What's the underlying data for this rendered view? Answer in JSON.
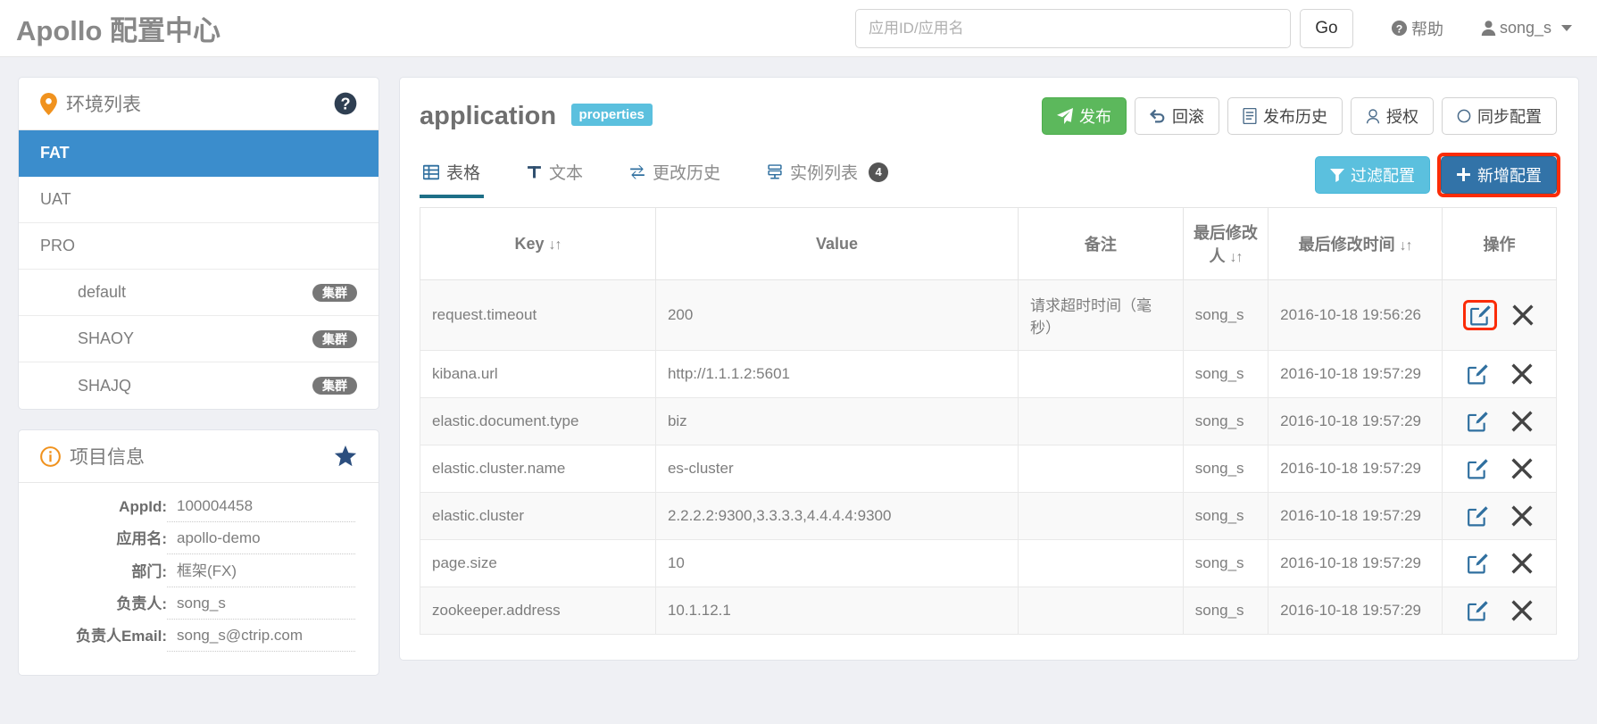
{
  "header": {
    "brand_en": "Apollo",
    "brand_cn": " 配置中心",
    "search_placeholder": "应用ID/应用名",
    "search_value": "",
    "go_label": "Go",
    "help_label": "帮助",
    "user_label": "song_s"
  },
  "sidebar": {
    "env_panel_title": "环境列表",
    "environments": [
      {
        "label": "FAT",
        "active": true,
        "cluster": false,
        "badge": ""
      },
      {
        "label": "UAT",
        "active": false,
        "cluster": false,
        "badge": ""
      },
      {
        "label": "PRO",
        "active": false,
        "cluster": false,
        "badge": ""
      },
      {
        "label": "default",
        "active": false,
        "cluster": true,
        "badge": "集群"
      },
      {
        "label": "SHAOY",
        "active": false,
        "cluster": true,
        "badge": "集群"
      },
      {
        "label": "SHAJQ",
        "active": false,
        "cluster": true,
        "badge": "集群"
      }
    ],
    "info_panel_title": "项目信息",
    "info_rows": [
      {
        "label": "AppId:",
        "value": "100004458"
      },
      {
        "label": "应用名:",
        "value": "apollo-demo"
      },
      {
        "label": "部门:",
        "value": "框架(FX)"
      },
      {
        "label": "负责人:",
        "value": "song_s"
      },
      {
        "label": "负责人Email:",
        "value": "song_s@ctrip.com"
      }
    ]
  },
  "main": {
    "namespace": "application",
    "format_badge": "properties",
    "actions": [
      {
        "label": "发布",
        "icon": "paper-plane-icon",
        "style": "green"
      },
      {
        "label": "回滚",
        "icon": "undo-icon",
        "style": "default"
      },
      {
        "label": "发布历史",
        "icon": "file-text-icon",
        "style": "default"
      },
      {
        "label": "授权",
        "icon": "user-icon",
        "style": "default"
      },
      {
        "label": "同步配置",
        "icon": "circle-o-icon",
        "style": "default"
      }
    ],
    "tabs": [
      {
        "label": "表格",
        "icon": "table-icon",
        "active": true,
        "badge": ""
      },
      {
        "label": "文本",
        "icon": "text-icon",
        "active": false,
        "badge": ""
      },
      {
        "label": "更改历史",
        "icon": "exchange-icon",
        "active": false,
        "badge": ""
      },
      {
        "label": "实例列表",
        "icon": "server-icon",
        "active": false,
        "badge": "4"
      }
    ],
    "filter_label": "过滤配置",
    "add_label": "新增配置",
    "table": {
      "columns": [
        {
          "label": "Key",
          "sortable": true
        },
        {
          "label": "Value",
          "sortable": false
        },
        {
          "label": "备注",
          "sortable": false
        },
        {
          "label": "最后修改人",
          "sortable": true
        },
        {
          "label": "最后修改时间",
          "sortable": true
        },
        {
          "label": "操作",
          "sortable": false
        }
      ],
      "rows": [
        {
          "key": "request.timeout",
          "value": "200",
          "note": "请求超时时间（毫秒）",
          "user": "song_s",
          "time": "2016-10-18 19:56:26",
          "edit_highlighted": true
        },
        {
          "key": "kibana.url",
          "value": "http://1.1.1.2:5601",
          "note": "",
          "user": "song_s",
          "time": "2016-10-18 19:57:29",
          "edit_highlighted": false
        },
        {
          "key": "elastic.document.type",
          "value": "biz",
          "note": "",
          "user": "song_s",
          "time": "2016-10-18 19:57:29",
          "edit_highlighted": false
        },
        {
          "key": "elastic.cluster.name",
          "value": "es-cluster",
          "note": "",
          "user": "song_s",
          "time": "2016-10-18 19:57:29",
          "edit_highlighted": false
        },
        {
          "key": "elastic.cluster",
          "value": "2.2.2.2:9300,3.3.3.3,4.4.4.4:9300",
          "note": "",
          "user": "song_s",
          "time": "2016-10-18 19:57:29",
          "edit_highlighted": false
        },
        {
          "key": "page.size",
          "value": "10",
          "note": "",
          "user": "song_s",
          "time": "2016-10-18 19:57:29",
          "edit_highlighted": false
        },
        {
          "key": "zookeeper.address",
          "value": "10.1.12.1",
          "note": "",
          "user": "song_s",
          "time": "2016-10-18 19:57:29",
          "edit_highlighted": false
        }
      ]
    }
  },
  "colors": {
    "accent_blue": "#3b8dcc",
    "badge_cyan": "#5bc0de",
    "publish_green": "#5cb85c",
    "add_blue": "#3273a8",
    "highlight_red": "#fb2c08",
    "marker_orange": "#f0921e",
    "star_navy": "#2b4e7e",
    "tab_active": "#1e6f87"
  }
}
